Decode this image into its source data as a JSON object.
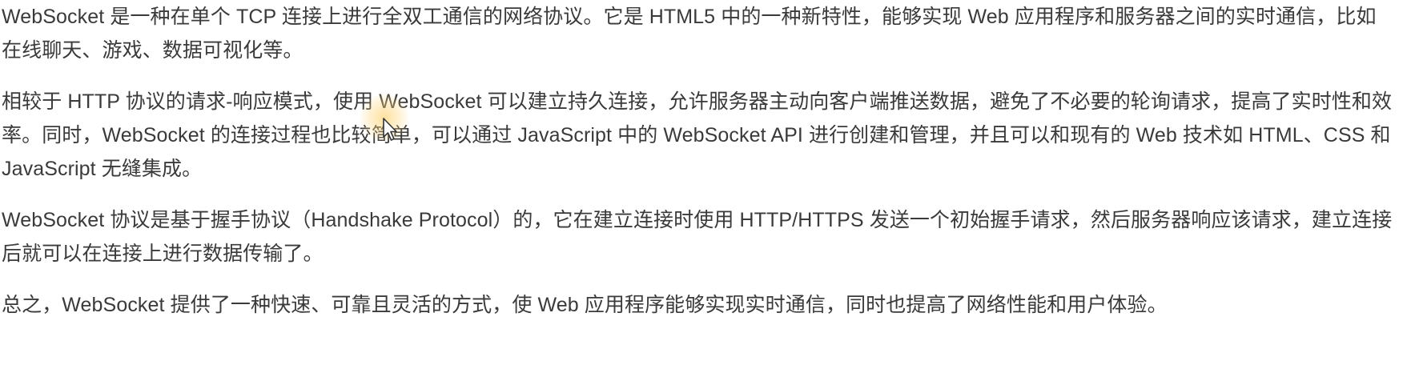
{
  "article": {
    "paragraphs": [
      "WebSocket 是一种在单个 TCP 连接上进行全双工通信的网络协议。它是 HTML5 中的一种新特性，能够实现 Web 应用程序和服务器之间的实时通信，比如在线聊天、游戏、数据可视化等。",
      "相较于 HTTP 协议的请求-响应模式，使用 WebSocket 可以建立持久连接，允许服务器主动向客户端推送数据，避免了不必要的轮询请求，提高了实时性和效率。同时，WebSocket 的连接过程也比较简单，可以通过 JavaScript 中的 WebSocket API 进行创建和管理，并且可以和现有的 Web 技术如 HTML、CSS 和 JavaScript 无缝集成。",
      "WebSocket 协议是基于握手协议（Handshake Protocol）的，它在建立连接时使用 HTTP/HTTPS 发送一个初始握手请求，然后服务器响应该请求，建立连接后就可以在连接上进行数据传输了。",
      "总之，WebSocket 提供了一种快速、可靠且灵活的方式，使 Web 应用程序能够实现实时通信，同时也提高了网络性能和用户体验。"
    ]
  },
  "cursor": {
    "icon": "mouse-pointer-icon",
    "highlight_color": "#ffc850"
  }
}
